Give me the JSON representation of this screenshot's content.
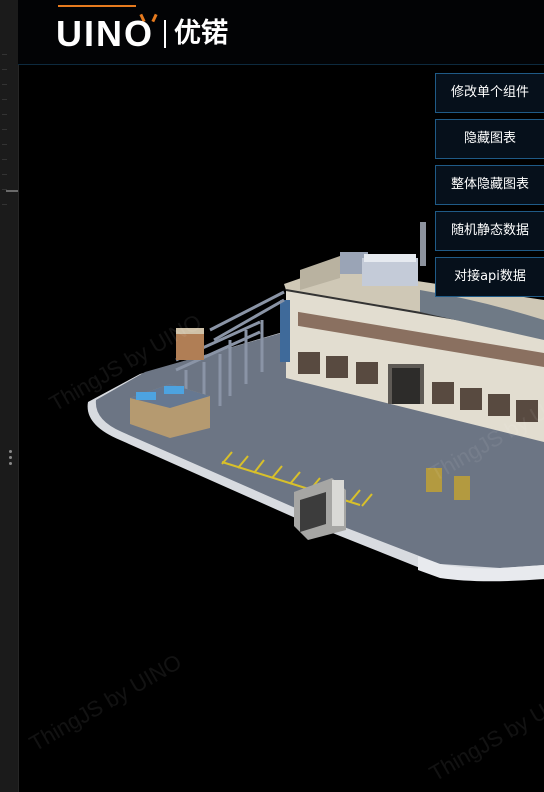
{
  "header": {
    "logo_word": "UINO",
    "logo_cn": "优锘",
    "accent_color": "#e67a1e"
  },
  "buttons": [
    {
      "label": "修改单个组件"
    },
    {
      "label": "隐藏图表"
    },
    {
      "label": "整体隐藏图表"
    },
    {
      "label": "随机静态数据"
    },
    {
      "label": "对接api数据"
    }
  ],
  "watermarks": [
    {
      "text": "ThingJS by UINO"
    },
    {
      "text": "ThingJS by UINO"
    },
    {
      "text": "ThingJS by UINO"
    },
    {
      "text": "ThingJS by UINO"
    }
  ],
  "scene": {
    "description_icon": "factory-3d-model-icon"
  }
}
